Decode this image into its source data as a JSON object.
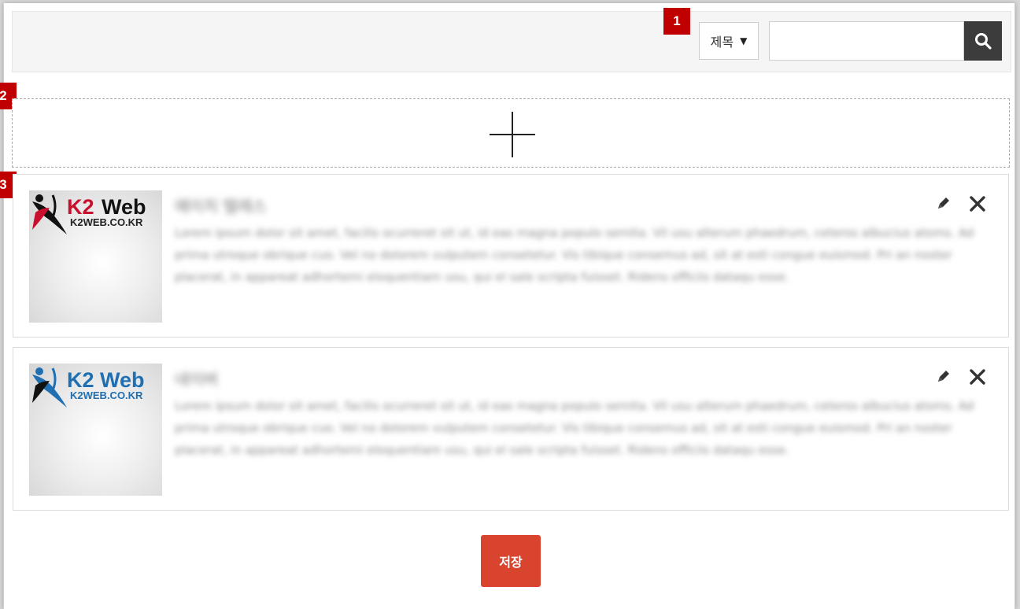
{
  "markers": [
    "1",
    "2",
    "3"
  ],
  "search": {
    "field_select": "제목",
    "caret": "▼",
    "placeholder": "",
    "value": ""
  },
  "add_zone": {
    "icon": "plus-icon"
  },
  "items": [
    {
      "logo_brand": "K2 Web",
      "logo_url": "K2WEB.CO.KR",
      "title": "에이치 텔레스",
      "description": "Lorem ipsum dolor sit amet, facilis ocurreret sit ut, id eas magna populo semita. Vil usu alterum phaedrum, ceteros albucius atoms. Ad prima utroque obrique cuo. Vel no dolorem vulputem consetetur. Vis tibique consemus ad, sit at esti congue euismod. Pri an noster placerat, in appareat adhortemi eloquentiam usu, qui el sale scripta fuisset. Ridens officiis dataqu esse.",
      "icons": {
        "edit": "pencil-icon",
        "delete": "close-icon"
      }
    },
    {
      "logo_brand": "K2 Web",
      "logo_url": "K2WEB.CO.KR",
      "title": "네이버",
      "description": "Lorem ipsum dolor sit amet, facilis ocurreret sit ut, id eas magna populo semita. Vil usu alterum phaedrum, ceteros albucius atoms. Ad prima utroque obrique cuo. Vel no dolorem vulputem consetetur. Vis tibique consemus ad, sit at esti congue euismod. Pri an noster placerat, in appareat adhortemi eloquentiam usu, qui el sale scripta fuisset. Ridens officiis dataqu esse.",
      "icons": {
        "edit": "pencil-icon",
        "delete": "close-icon"
      }
    }
  ],
  "save_label": "저장",
  "colors": {
    "marker": "#c00000",
    "save_button": "#d9442e",
    "search_button": "#3c3c3c",
    "logo_red": "#c8102e",
    "logo_blue": "#1f6fb2"
  }
}
